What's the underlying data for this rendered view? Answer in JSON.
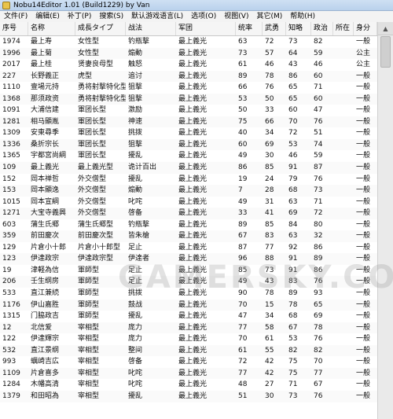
{
  "window": {
    "title": "Nobu14Editor 1.01 (Build1229) by Van"
  },
  "menu": [
    "文件(F)",
    "编辑(E)",
    "补丁(P)",
    "搜索(S)",
    "默认游戏语言(L)",
    "选项(O)",
    "视图(V)",
    "其它(M)",
    "帮助(H)"
  ],
  "columns": [
    "序号",
    "名称",
    "成長タイプ",
    "战法",
    "军团",
    "统率",
    "武勇",
    "知略",
    "政治",
    "所在",
    "身分"
  ],
  "rows": [
    [
      "1974",
      "最上寿",
      "女性型",
      "钓瓶撃",
      "最上義光",
      "63",
      "72",
      "73",
      "82",
      "",
      "一般"
    ],
    [
      "1996",
      "最上菊",
      "女性型",
      "煽動",
      "最上義光",
      "73",
      "57",
      "64",
      "59",
      "",
      "公主"
    ],
    [
      "2017",
      "最上桂",
      "贤妻良母型",
      "触怒",
      "最上義光",
      "61",
      "46",
      "43",
      "46",
      "",
      "公主"
    ],
    [
      "227",
      "长野義正",
      "虎型",
      "追讨",
      "最上義光",
      "89",
      "78",
      "86",
      "60",
      "",
      "一般"
    ],
    [
      "1110",
      "壹場元持",
      "勇将射撃特化型",
      "狙撃",
      "最上義光",
      "66",
      "76",
      "65",
      "71",
      "",
      "一般"
    ],
    [
      "1368",
      "那须政资",
      "勇将射撃特化型",
      "狙撃",
      "最上義光",
      "53",
      "50",
      "65",
      "60",
      "",
      "一般"
    ],
    [
      "1091",
      "大浦信建",
      "軍团长型",
      "激励",
      "最上義光",
      "50",
      "33",
      "60",
      "47",
      "",
      "一般"
    ],
    [
      "1281",
      "相马顯胤",
      "軍团长型",
      "神速",
      "最上義光",
      "75",
      "66",
      "70",
      "76",
      "",
      "一般"
    ],
    [
      "1309",
      "安東尋季",
      "軍团长型",
      "挑拨",
      "最上義光",
      "40",
      "34",
      "72",
      "51",
      "",
      "一般"
    ],
    [
      "1336",
      "桑折宗长",
      "軍团长型",
      "狙撃",
      "最上義光",
      "60",
      "69",
      "53",
      "74",
      "",
      "一般"
    ],
    [
      "1365",
      "宇都宮尚綱",
      "軍团长型",
      "擾乱",
      "最上義光",
      "49",
      "30",
      "46",
      "59",
      "",
      "一般"
    ],
    [
      "109",
      "最上義光",
      "最上義光型",
      "诡计百出",
      "最上義光",
      "86",
      "85",
      "91",
      "87",
      "",
      "一般"
    ],
    [
      "152",
      "岡本禅哲",
      "外交僧型",
      "擾乱",
      "最上義光",
      "19",
      "24",
      "79",
      "76",
      "",
      "一般"
    ],
    [
      "153",
      "岡本顯逸",
      "外交僧型",
      "煽動",
      "最上義光",
      "7",
      "28",
      "68",
      "73",
      "",
      "一般"
    ],
    [
      "1015",
      "岡本宣綱",
      "外交僧型",
      "叱咤",
      "最上義光",
      "49",
      "31",
      "63",
      "71",
      "",
      "一般"
    ],
    [
      "1271",
      "大宝寺義興",
      "外交僧型",
      "啓备",
      "最上義光",
      "33",
      "41",
      "69",
      "72",
      "",
      "一般"
    ],
    [
      "603",
      "蒲生氏郷",
      "蒲生氏郷型",
      "钓瓶撃",
      "最上義光",
      "89",
      "85",
      "84",
      "80",
      "",
      "一般"
    ],
    [
      "359",
      "前田慶次",
      "前田慶次型",
      "皆朱槍",
      "最上義光",
      "67",
      "83",
      "63",
      "32",
      "",
      "一般"
    ],
    [
      "129",
      "片倉小十郎",
      "片倉小十郎型",
      "足止",
      "最上義光",
      "87",
      "77",
      "92",
      "86",
      "",
      "一般"
    ],
    [
      "123",
      "伊達政宗",
      "伊達政宗型",
      "伊達者",
      "最上義光",
      "96",
      "88",
      "91",
      "89",
      "",
      "一般"
    ],
    [
      "19",
      "津軽為信",
      "軍師型",
      "足止",
      "最上義光",
      "85",
      "73",
      "91",
      "86",
      "",
      "一般"
    ],
    [
      "206",
      "壬生纲房",
      "軍師型",
      "足止",
      "最上義光",
      "49",
      "43",
      "83",
      "76",
      "",
      "一般"
    ],
    [
      "533",
      "直江兼続",
      "軍師型",
      "挑拨",
      "最上義光",
      "90",
      "78",
      "89",
      "93",
      "",
      "一般"
    ],
    [
      "1176",
      "伊山嘉胜",
      "軍師型",
      "鼓战",
      "最上義光",
      "70",
      "15",
      "78",
      "65",
      "",
      "一般"
    ],
    [
      "1315",
      "门脇政吉",
      "軍師型",
      "擾乱",
      "最上義光",
      "47",
      "34",
      "68",
      "69",
      "",
      "一般"
    ],
    [
      "12",
      "北信爱",
      "宰相型",
      "庞力",
      "最上義光",
      "77",
      "58",
      "67",
      "78",
      "",
      "一般"
    ],
    [
      "122",
      "伊達輝宗",
      "宰相型",
      "庞力",
      "最上義光",
      "70",
      "61",
      "53",
      "76",
      "",
      "一般"
    ],
    [
      "532",
      "直江景纲",
      "宰相型",
      "整间",
      "最上義光",
      "61",
      "55",
      "82",
      "82",
      "",
      "一般"
    ],
    [
      "993",
      "蠣崎吉広",
      "宰相型",
      "啓备",
      "最上義光",
      "72",
      "42",
      "75",
      "70",
      "",
      "一般"
    ],
    [
      "1109",
      "片倉喜多",
      "宰相型",
      "叱咤",
      "最上義光",
      "77",
      "42",
      "75",
      "77",
      "",
      "一般"
    ],
    [
      "1284",
      "木幡高清",
      "宰相型",
      "叱咤",
      "最上義光",
      "48",
      "27",
      "71",
      "67",
      "",
      "一般"
    ],
    [
      "1379",
      "和田昭為",
      "宰相型",
      "擾乱",
      "最上義光",
      "51",
      "30",
      "73",
      "76",
      "",
      "一般"
    ]
  ],
  "watermark": "GAMERSKY.COM"
}
